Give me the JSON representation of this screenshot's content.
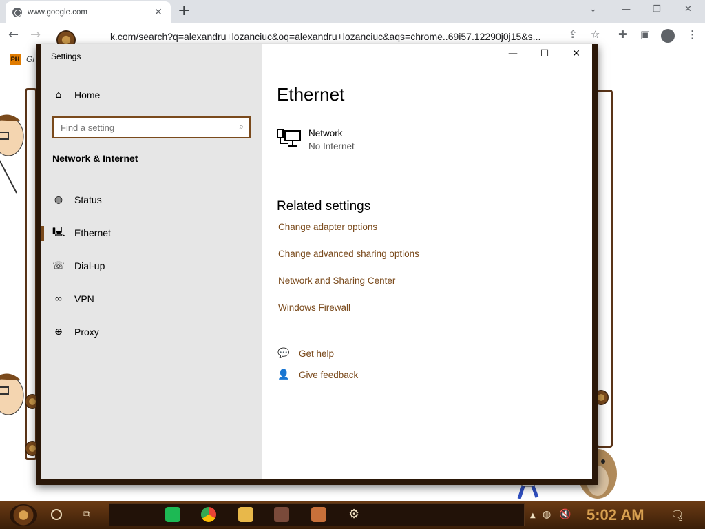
{
  "browser": {
    "tab_title": "www.google.com",
    "tab_close": "✕",
    "new_tab": "+",
    "url_text": "k.com/search?q=alexandru+lozanciuc&oq=alexandru+lozanciuc&aqs=chrome..69i57.12290j0j15&s...",
    "bookmark_badge": "PH",
    "bookmark_label": "Gi"
  },
  "settings": {
    "window_title": "Settings",
    "titlebar": {
      "minimize": "—",
      "maximize": "☐",
      "close": "✕"
    },
    "sidebar": {
      "home_label": "Home",
      "search_placeholder": "Find a setting",
      "section_title": "Network & Internet",
      "items": [
        {
          "label": "Status",
          "icon": "globe-icon"
        },
        {
          "label": "Ethernet",
          "icon": "ethernet-icon",
          "active": true
        },
        {
          "label": "Dial-up",
          "icon": "dialup-icon"
        },
        {
          "label": "VPN",
          "icon": "vpn-icon"
        },
        {
          "label": "Proxy",
          "icon": "proxy-icon"
        }
      ]
    },
    "content": {
      "page_title": "Ethernet",
      "network_name": "Network",
      "network_status": "No Internet",
      "related_title": "Related settings",
      "links": [
        "Change adapter options",
        "Change advanced sharing options",
        "Network and Sharing Center",
        "Windows Firewall"
      ],
      "help": [
        {
          "label": "Get help",
          "icon": "help-icon"
        },
        {
          "label": "Give feedback",
          "icon": "feedback-icon"
        }
      ]
    }
  },
  "taskbar": {
    "clock": "5:02 AM",
    "notification_count": "2"
  },
  "colors": {
    "accent": "#7a4a1c",
    "sidebar_bg": "#e6e6e6",
    "taskbar_bg": "#4a2a0e",
    "clock": "#d8a050"
  }
}
